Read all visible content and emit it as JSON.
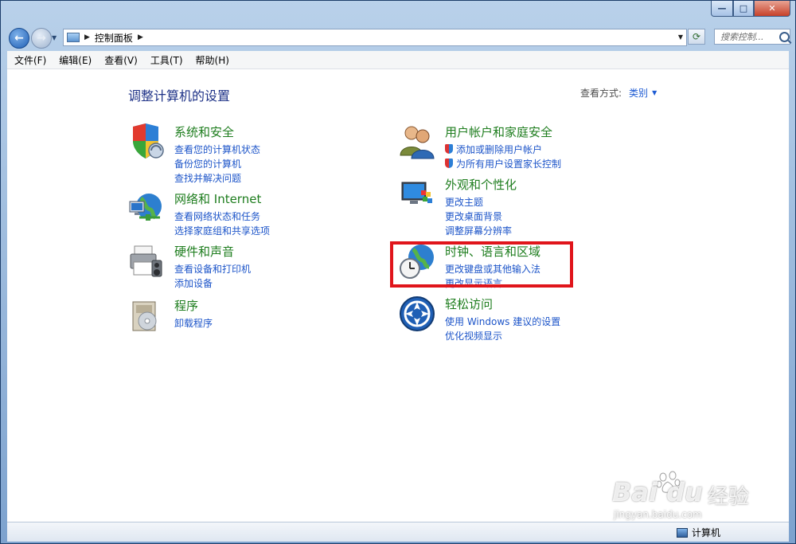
{
  "address": {
    "crumb": "控制面板"
  },
  "search": {
    "placeholder": "搜索控制..."
  },
  "menu": [
    {
      "label": "文件(F)"
    },
    {
      "label": "编辑(E)"
    },
    {
      "label": "查看(V)"
    },
    {
      "label": "工具(T)"
    },
    {
      "label": "帮助(H)"
    }
  ],
  "page": {
    "title": "调整计算机的设置",
    "view_by_label": "查看方式:",
    "view_by_value": "类别"
  },
  "categories": {
    "system": {
      "title": "系统和安全",
      "icon": "shield-icon",
      "links": [
        "查看您的计算机状态",
        "备份您的计算机",
        "查找并解决问题"
      ]
    },
    "network": {
      "title": "网络和 Internet",
      "icon": "network-globe-icon",
      "links": [
        "查看网络状态和任务",
        "选择家庭组和共享选项"
      ]
    },
    "hardware": {
      "title": "硬件和声音",
      "icon": "printer-icon",
      "links": [
        "查看设备和打印机",
        "添加设备"
      ]
    },
    "programs": {
      "title": "程序",
      "icon": "programs-box-icon",
      "links": [
        "卸载程序"
      ]
    },
    "users": {
      "title": "用户帐户和家庭安全",
      "icon": "users-icon",
      "links": [
        "添加或删除用户帐户",
        "为所有用户设置家长控制"
      ]
    },
    "appearance": {
      "title": "外观和个性化",
      "icon": "monitor-paint-icon",
      "links": [
        "更改主题",
        "更改桌面背景",
        "调整屏幕分辨率"
      ]
    },
    "clock": {
      "title": "时钟、语言和区域",
      "icon": "clock-globe-icon",
      "links": [
        "更改键盘或其他输入法",
        "更改显示语言"
      ]
    },
    "ease": {
      "title": "轻松访问",
      "icon": "ease-of-access-icon",
      "links": [
        "使用 Windows 建议的设置",
        "优化视频显示"
      ]
    }
  },
  "status": {
    "computer": "计算机"
  },
  "watermark": {
    "brand": "Bai du",
    "cn": "经验",
    "url": "jingyan.baidu.com"
  },
  "colors": {
    "highlight_box": "#e0151b",
    "link": "#1d55c9",
    "category_title": "#1e7d1e",
    "heading": "#1e3287"
  }
}
